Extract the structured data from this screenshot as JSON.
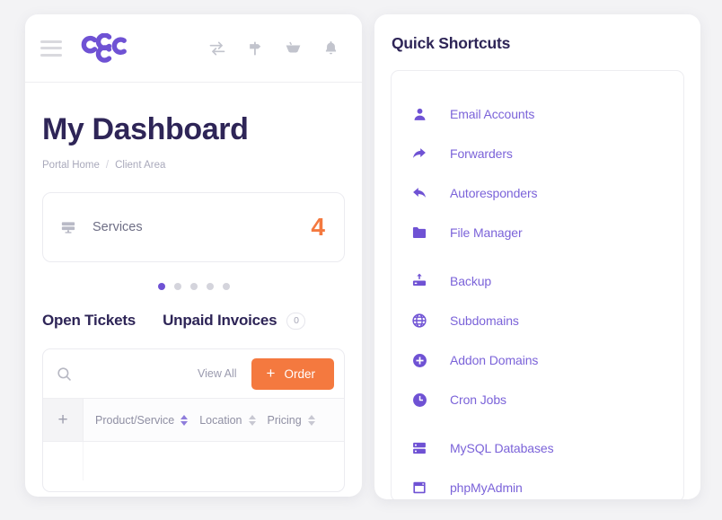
{
  "theme": {
    "page_background": "#f3f3f5",
    "brand_purple": "#6f52d4",
    "link_purple": "#7b63d9",
    "accent_orange": "#f4793f",
    "heading_navy": "#2e2557",
    "muted_gray": "#a9a9bb"
  },
  "left_panel": {
    "topbar": {
      "menu_icon": "hamburger-menu-icon",
      "logo_alt": "cyberpanel-logo",
      "icons": [
        {
          "name": "transfer-icon",
          "label": "Transfer"
        },
        {
          "name": "signpost-icon",
          "label": "Announcements"
        },
        {
          "name": "shopping-basket-icon",
          "label": "Cart"
        },
        {
          "name": "bell-icon",
          "label": "Notifications"
        }
      ]
    },
    "title": "My Dashboard",
    "breadcrumb": {
      "home": "Portal Home",
      "separator": "/",
      "current": "Client Area"
    },
    "stat_card": {
      "icon": "server-monitor-icon",
      "label": "Services",
      "count": "4"
    },
    "carousel": {
      "total_dots": 5,
      "active_index": 0
    },
    "tabs": [
      {
        "label": "Open Tickets",
        "badge": null,
        "active": true
      },
      {
        "label": "Unpaid Invoices",
        "badge": "0",
        "active": false
      }
    ],
    "table_toolbar": {
      "search_icon": "search-icon",
      "search_placeholder": "",
      "view_all_label": "View All",
      "order_button": {
        "plus": "+",
        "label": "Order"
      }
    },
    "table": {
      "expand_column_label": "+",
      "columns": [
        {
          "label": "Product/Service",
          "sortable": true,
          "sort_highlight": true
        },
        {
          "label": "Location",
          "sortable": true,
          "sort_highlight": false
        },
        {
          "label": "Pricing",
          "sortable": true,
          "sort_highlight": false
        }
      ],
      "rows": []
    }
  },
  "right_panel": {
    "title": "Quick Shortcuts",
    "groups": [
      {
        "items": [
          {
            "icon": "user-icon",
            "label": "Email Accounts"
          },
          {
            "icon": "forward-arrow-icon",
            "label": "Forwarders"
          },
          {
            "icon": "reply-arrow-icon",
            "label": "Autoresponders"
          },
          {
            "icon": "folder-icon",
            "label": "File Manager"
          }
        ]
      },
      {
        "items": [
          {
            "icon": "backup-upload-icon",
            "label": "Backup"
          },
          {
            "icon": "globe-icon",
            "label": "Subdomains"
          },
          {
            "icon": "plus-circle-icon",
            "label": "Addon Domains"
          },
          {
            "icon": "clock-icon",
            "label": "Cron Jobs"
          }
        ]
      },
      {
        "items": [
          {
            "icon": "database-icon",
            "label": "MySQL Databases"
          },
          {
            "icon": "browser-window-icon",
            "label": "phpMyAdmin"
          }
        ]
      }
    ]
  }
}
